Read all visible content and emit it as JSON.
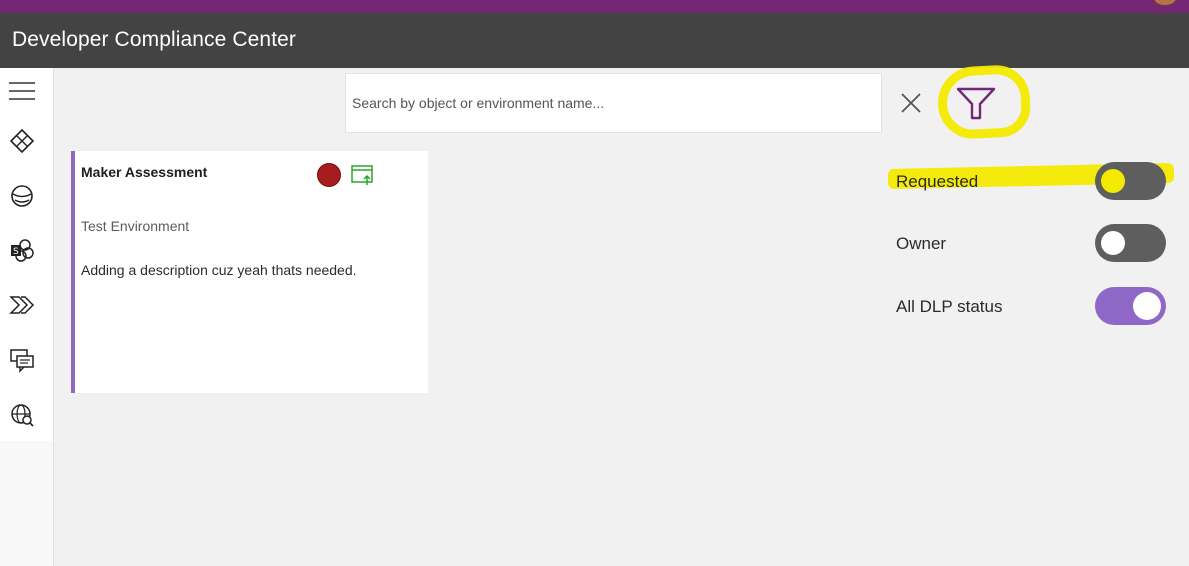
{
  "app": {
    "title": "Developer Compliance Center"
  },
  "nav": {
    "items": [
      {
        "icon": "hamburger-menu-icon"
      },
      {
        "icon": "power-apps-icon"
      },
      {
        "icon": "dataverse-icon"
      },
      {
        "icon": "sharepoint-connectors-icon"
      },
      {
        "icon": "power-automate-icon"
      },
      {
        "icon": "chat-bot-icon"
      },
      {
        "icon": "globe-search-icon"
      }
    ]
  },
  "search": {
    "placeholder": "Search by object or environment name...",
    "value": ""
  },
  "toolbar": {
    "clear_icon": "close-icon",
    "filter_icon": "filter-icon"
  },
  "card": {
    "title": "Maker Assessment",
    "environment": "Test Environment",
    "description": "Adding a description cuz yeah thats needed.",
    "status_color": "#a61d1d",
    "open_icon": "open-in-window-icon"
  },
  "filters": [
    {
      "label": "Requested",
      "on": false
    },
    {
      "label": "Owner",
      "on": false
    },
    {
      "label": "All DLP status",
      "on": true
    }
  ],
  "colors": {
    "brand": "#742774",
    "header": "#434343",
    "toggle_on": "#8f67c7",
    "toggle_off": "#5e5e5e",
    "highlight": "#f3ea00"
  }
}
